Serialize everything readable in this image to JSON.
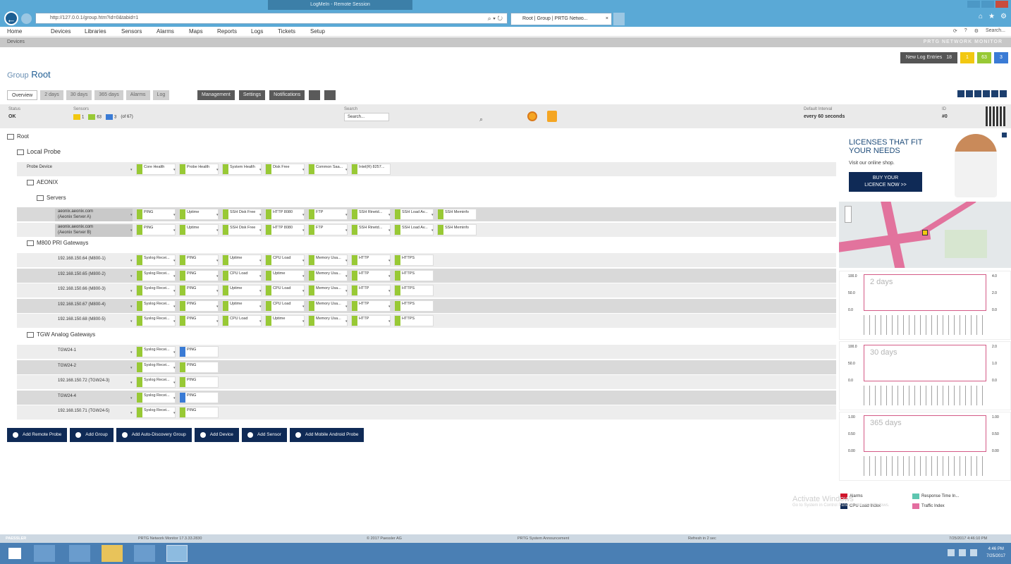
{
  "browser": {
    "remote_title": "LogMeIn - Remote Session",
    "url": "http://127.0.0.1/group.htm?id=0&tabid=1",
    "tab_title": "Root | Group | PRTG Netwo...",
    "tab_close": "×"
  },
  "menu": {
    "items": [
      "Home",
      "Devices",
      "Libraries",
      "Sensors",
      "Alarms",
      "Maps",
      "Reports",
      "Logs",
      "Tickets",
      "Setup"
    ],
    "right": [
      "⟳",
      "?",
      "⚙",
      "Search..."
    ]
  },
  "breadcrumb": "Devices",
  "brand": "PRTG NETWORK MONITOR",
  "toolbar": {
    "new_log_entries": "New Log Entries",
    "new_count": "18"
  },
  "status_squares": [
    {
      "label": "1",
      "color": "#f2c811"
    },
    {
      "label": "63",
      "color": "#98c935"
    },
    {
      "label": "3",
      "color": "#3a7bd5"
    }
  ],
  "title": {
    "prefix": "Group",
    "name": "Root"
  },
  "tabs": [
    "Overview",
    "2 days",
    "30 days",
    "365 days",
    "Alarms",
    "Log"
  ],
  "actions": [
    "Management",
    "Settings",
    "Notifications"
  ],
  "status": {
    "status_label": "Status",
    "status_value": "OK",
    "sensors_label": "Sensors",
    "counts": [
      {
        "value": "1",
        "color": "#f2c811"
      },
      {
        "value": "63",
        "color": "#98c935"
      },
      {
        "value": "3",
        "color": "#3a7bd5"
      }
    ],
    "total": "(of 67)",
    "search_label": "Search",
    "search_placeholder": "Search...",
    "interval_label": "Default Interval",
    "interval_value": "every 60 seconds",
    "id_label": "ID",
    "id_value": "#0"
  },
  "tree": {
    "root": "Root",
    "probe": "Local Probe",
    "probe_device": "Probe Device",
    "probe_sensors": [
      "Core Health",
      "Probe Health",
      "System Health",
      "Disk Free",
      "Common Saa...",
      "Intel(R) 8257..."
    ],
    "group_aeonix": "AEONIX",
    "group_servers": "Servers",
    "servers": [
      {
        "name": "aeonix.aeonix.com\n(Aeonix Server A)",
        "sensors": [
          "PING",
          "Uptime",
          "SSH Disk Free",
          "HTTP 8080",
          "FTP",
          "SSH Rinetd...",
          "SSH Load Av...",
          "SSH Meminfo"
        ]
      },
      {
        "name": "aeonix.aeonix.com\n(Aeonix Server B)",
        "sensors": [
          "PING",
          "Uptime",
          "SSH Disk Free",
          "HTTP 8080",
          "FTP",
          "SSH Rinetd...",
          "SSH Load Av...",
          "SSH Meminfo"
        ]
      }
    ],
    "group_m800": "M800 PRI Gateways",
    "m800": [
      {
        "name": "192.168.150.64 (M800-1)",
        "sensors": [
          "Syslog Recei...",
          "PING",
          "Uptime",
          "CPU Load",
          "Memory Usa...",
          "HTTP",
          "HTTPS"
        ]
      },
      {
        "name": "192.168.150.65 (M800-2)",
        "sensors": [
          "Syslog Recei...",
          "PING",
          "CPU Load",
          "Uptime",
          "Memory Usa...",
          "HTTP",
          "HTTPS"
        ]
      },
      {
        "name": "192.168.150.66 (M800-3)",
        "sensors": [
          "Syslog Recei...",
          "PING",
          "Uptime",
          "CPU Load",
          "Memory Usa...",
          "HTTP",
          "HTTPS"
        ]
      },
      {
        "name": "192.168.150.67 (M800-4)",
        "sensors": [
          "Syslog Recei...",
          "PING",
          "Uptime",
          "CPU Load",
          "Memory Usa...",
          "HTTP",
          "HTTPS"
        ]
      },
      {
        "name": "192.168.150.68 (M800-5)",
        "sensors": [
          "Syslog Recei...",
          "PING",
          "CPU Load",
          "Uptime",
          "Memory Usa...",
          "HTTP",
          "HTTPS"
        ]
      }
    ],
    "group_tgw": "TGW Analog Gateways",
    "tgw": [
      {
        "name": "TGW24-1",
        "sensors": [
          "Syslog Recei...",
          "PING"
        ],
        "second_blue": true
      },
      {
        "name": "TGW24-2",
        "sensors": [
          "Syslog Recei...",
          "PING"
        ],
        "second_blue": false
      },
      {
        "name": "192.168.150.72 (TGW24-3)",
        "sensors": [
          "Syslog Recei...",
          "PING"
        ],
        "second_blue": false
      },
      {
        "name": "TGW24-4",
        "sensors": [
          "Syslog Recei...",
          "PING"
        ],
        "second_blue": true
      },
      {
        "name": "192.168.150.71 (TGW24-5)",
        "sensors": [
          "Syslog Recei...",
          "PING"
        ],
        "second_blue": false
      }
    ]
  },
  "add_buttons": [
    "Add Remote Probe",
    "Add Group",
    "Add Auto-Discovery Group",
    "Add Device",
    "Add Sensor",
    "Add Mobile Android Probe"
  ],
  "ad": {
    "headline": "LICENSES THAT FIT YOUR NEEDS",
    "sub": "Visit our online shop.",
    "cta_line1": "BUY YOUR",
    "cta_line2": "LICENCE NOW >>"
  },
  "charts": [
    {
      "label": "2 days",
      "ytop": "100.0",
      "ymid": "50.0",
      "ybot": "0.0",
      "rtop": "4.0",
      "rmid": "2.0",
      "rbot": "0.0"
    },
    {
      "label": "30 days",
      "ytop": "100.0",
      "ymid": "50.0",
      "ybot": "0.0",
      "rtop": "2.0",
      "rmid": "1.0",
      "rbot": "0.0"
    },
    {
      "label": "365 days",
      "ytop": "1.00",
      "ymid": "0.50",
      "ybot": "0.00",
      "rtop": "1.00",
      "rmid": "0.50",
      "rbot": "0.00"
    }
  ],
  "legend": [
    {
      "label": "Alarms",
      "color": "#d0142c"
    },
    {
      "label": "Response Time In...",
      "color": "#5ec6b0"
    },
    {
      "label": "CPU Load Index",
      "color": "#0f2a56"
    },
    {
      "label": "Traffic Index",
      "color": "#e36ea0"
    }
  ],
  "watermark": {
    "title": "Activate Windows",
    "sub": "Go to System in Control Panel to activate Windows."
  },
  "footer": {
    "logo": "PAESSLER",
    "version": "PRTG Network Monitor 17.3.33.2830",
    "copyright": "© 2017 Paessler AG",
    "announcement": "PRTG System Announcement",
    "refresh": "Refresh in 2 sec",
    "datetime": "7/25/2017 4:46:10 PM"
  },
  "taskbar": {
    "time": "4:46 PM",
    "date": "7/25/2017"
  }
}
